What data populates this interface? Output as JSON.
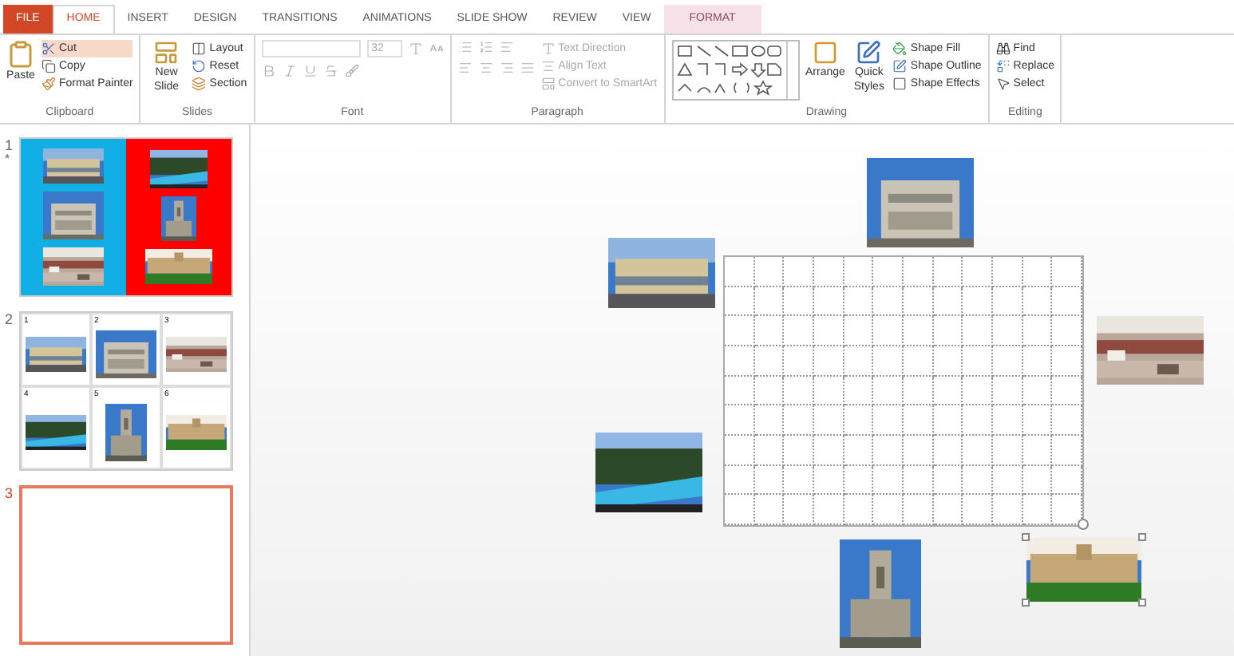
{
  "tabs": [
    {
      "label": "FILE",
      "kind": "file",
      "selected": false
    },
    {
      "label": "HOME",
      "kind": "normal",
      "selected": true
    },
    {
      "label": "INSERT",
      "kind": "normal",
      "selected": false
    },
    {
      "label": "DESIGN",
      "kind": "normal",
      "selected": false
    },
    {
      "label": "TRANSITIONS",
      "kind": "normal",
      "selected": false
    },
    {
      "label": "ANIMATIONS",
      "kind": "normal",
      "selected": false
    },
    {
      "label": "SLIDE SHOW",
      "kind": "normal",
      "selected": false
    },
    {
      "label": "REVIEW",
      "kind": "normal",
      "selected": false
    },
    {
      "label": "VIEW",
      "kind": "normal",
      "selected": false
    },
    {
      "label": "FORMAT",
      "kind": "contextual",
      "selected": false
    }
  ],
  "ribbon": {
    "clipboard": {
      "label": "Clipboard",
      "paste": "Paste",
      "cut": "Cut",
      "copy": "Copy",
      "format_painter": "Format Painter"
    },
    "slides": {
      "label": "Slides",
      "new_slide": "New Slide",
      "layout": "Layout",
      "reset": "Reset",
      "section": "Section"
    },
    "font": {
      "label": "Font",
      "size": "32"
    },
    "paragraph": {
      "label": "Paragraph",
      "text_direction": "Text Direction",
      "align_text": "Align Text",
      "convert": "Convert to SmartArt"
    },
    "drawing": {
      "label": "Drawing",
      "arrange": "Arrange",
      "quick_styles": "Quick Styles",
      "shape_fill": "Shape Fill",
      "shape_outline": "Shape Outline",
      "shape_effects": "Shape Effects"
    },
    "editing": {
      "label": "Editing",
      "find": "Find",
      "replace": "Replace",
      "select": "Select"
    }
  },
  "slides": [
    {
      "number": "1",
      "marker": "*",
      "kind": "split",
      "selected": false
    },
    {
      "number": "2",
      "kind": "grid",
      "selected": false,
      "cells": [
        "1",
        "2",
        "3",
        "4",
        "5",
        "6"
      ]
    },
    {
      "number": "3",
      "kind": "blank",
      "selected": true
    }
  ],
  "canvas": {
    "photos": [
      {
        "kind": "picture",
        "selected": false
      },
      {
        "kind": "picture",
        "selected": false
      },
      {
        "kind": "picture",
        "selected": false
      },
      {
        "kind": "picture",
        "selected": false
      },
      {
        "kind": "picture",
        "selected": false
      },
      {
        "kind": "picture",
        "selected": true
      }
    ]
  }
}
